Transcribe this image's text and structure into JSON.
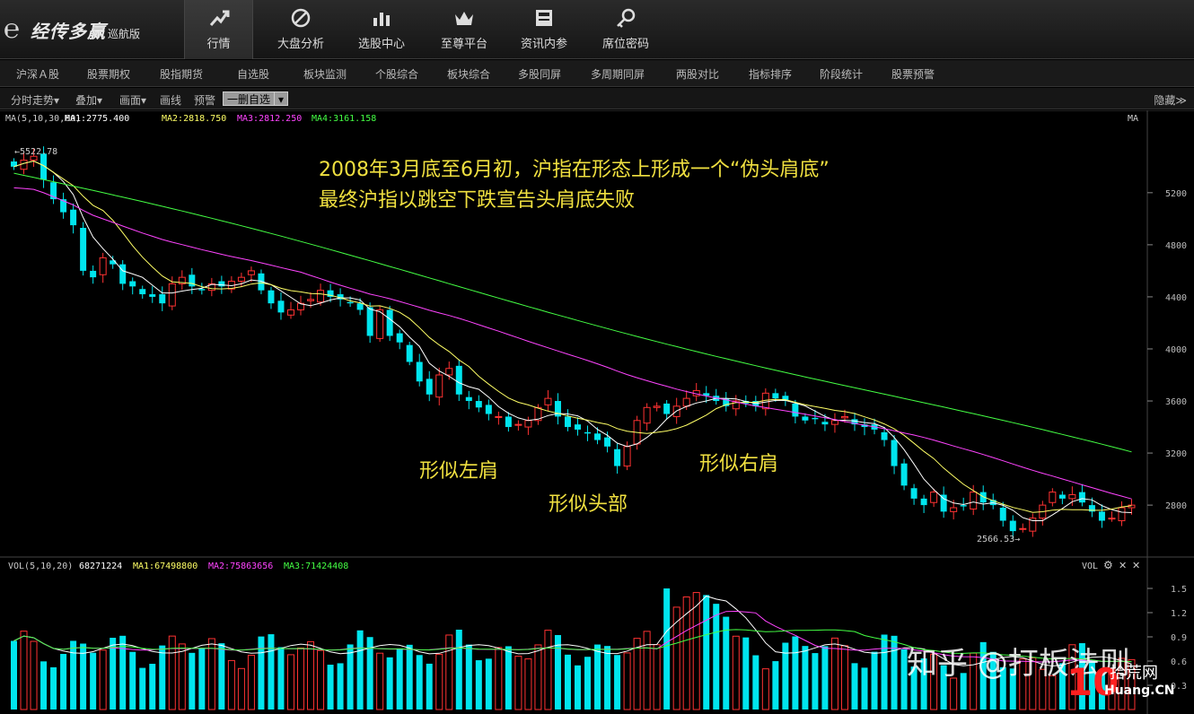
{
  "app": {
    "logo_title": "经传多赢",
    "logo_sub": "巡航版"
  },
  "nav": [
    {
      "label": "行情",
      "icon": "trend-icon"
    },
    {
      "label": "大盘分析",
      "icon": "compass-icon"
    },
    {
      "label": "选股中心",
      "icon": "bar-chart-icon"
    },
    {
      "label": "至尊平台",
      "icon": "crown-icon"
    },
    {
      "label": "资讯内参",
      "icon": "news-icon"
    },
    {
      "label": "席位密码",
      "icon": "key-icon"
    }
  ],
  "menu": [
    "沪深Ａ股",
    "股票期权",
    "股指期货",
    "自选股",
    "板块监测",
    "个股综合",
    "板块综合",
    "多股同屏",
    "多周期同屏",
    "两股对比",
    "指标排序",
    "阶段统计",
    "股票预警"
  ],
  "toolbar": {
    "items": [
      "分时走势▾",
      "叠加▾",
      "画面▾",
      "画线",
      "预警"
    ],
    "box_label": "一删自选",
    "hide_label": "隐藏≫"
  },
  "price_panel": {
    "ma_label": "MA(5,10,30,60)",
    "ma1": "MA1:2775.400",
    "ma2": "MA2:2818.750",
    "ma3": "MA3:2812.250",
    "ma4": "MA4:3161.158",
    "ma_corner": "MA",
    "high_mark": "←5522.78",
    "low_mark": "2566.53→",
    "y_ticks": [
      "5200",
      "4800",
      "4400",
      "4000",
      "3600",
      "3200",
      "2800"
    ],
    "annotation_line1": "2008年3月底至6月初，沪指在形态上形成一个“伪头肩底”",
    "annotation_line2": "最终沪指以跳空下跌宣告头肩底失败",
    "left_shoulder": "形似左肩",
    "head": "形似头部",
    "right_shoulder": "形似右肩"
  },
  "vol_panel": {
    "label": "VOL(5,10,20)",
    "value": "68271224",
    "ma1": "MA1:67498800",
    "ma2": "MA2:75863656",
    "ma3": "MA3:71424408",
    "corner": "VOL",
    "y_ticks": [
      "1.5",
      "1.2",
      "0.9",
      "0.6",
      "0.3"
    ]
  },
  "watermark": {
    "text": "知乎 @打板法则",
    "site": "Huang.CN",
    "site_prefix": "拾荒网"
  },
  "colors": {
    "up": "#ff3232",
    "down": "#00e5ee",
    "ma1": "#ffffff",
    "ma2": "#ffff66",
    "ma3": "#ff44ff",
    "ma4": "#44ff44",
    "text_yellow": "#f0e040"
  },
  "chart_data": {
    "type": "candlestick",
    "ylim": [
      2566.53,
      5522.78
    ],
    "closes": [
      5400,
      5450,
      5480,
      5300,
      5150,
      5050,
      4950,
      4600,
      4550,
      4700,
      4650,
      4500,
      4480,
      4420,
      4400,
      4350,
      4500,
      4550,
      4480,
      4450,
      4500,
      4480,
      4520,
      4550,
      4600,
      4450,
      4350,
      4280,
      4300,
      4350,
      4380,
      4450,
      4400,
      4380,
      4350,
      4300,
      4100,
      4300,
      4100,
      4050,
      3900,
      3750,
      3650,
      3800,
      3850,
      3650,
      3600,
      3550,
      3500,
      3480,
      3400,
      3420,
      3450,
      3550,
      3620,
      3480,
      3400,
      3380,
      3350,
      3300,
      3250,
      3100,
      3250,
      3450,
      3550,
      3560,
      3500,
      3560,
      3620,
      3680,
      3640,
      3600,
      3560,
      3600,
      3580,
      3560,
      3660,
      3620,
      3600,
      3480,
      3450,
      3460,
      3420,
      3450,
      3480,
      3420,
      3400,
      3380,
      3300,
      3100,
      2950,
      2850,
      2800,
      2900,
      2750,
      2780,
      2790,
      2900,
      2820,
      2800,
      2680,
      2600,
      2620,
      2700,
      2800,
      2900,
      2850,
      2880,
      2820,
      2750,
      2680,
      2700,
      2780,
      2800
    ]
  }
}
